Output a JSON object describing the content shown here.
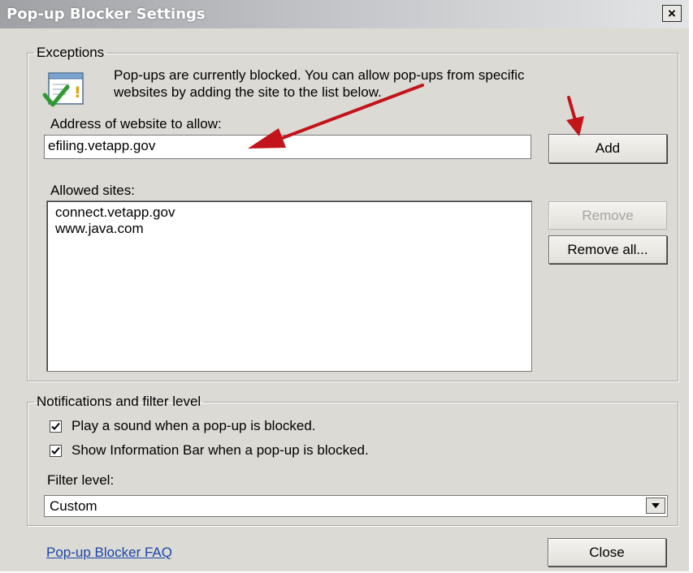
{
  "window": {
    "title": "Pop-up Blocker Settings",
    "close_glyph": "×"
  },
  "exceptions": {
    "legend": "Exceptions",
    "info_line1": "Pop-ups are currently blocked.  You can allow pop-ups from specific",
    "info_line2": "websites by adding the site to the list below.",
    "info_icon": "notepad-checkmark-warning-icon",
    "address_label": "Address of website to allow:",
    "address_value": "efiling.vetapp.gov",
    "add_label": "Add",
    "allowed_label": "Allowed sites:",
    "allowed_sites": [
      "connect.vetapp.gov",
      "www.java.com"
    ],
    "remove_label": "Remove",
    "remove_all_label": "Remove all..."
  },
  "notifications": {
    "legend": "Notifications and filter level",
    "play_sound_label": "Play a sound when a pop-up is blocked.",
    "play_sound_checked": true,
    "info_bar_label": "Show Information Bar when a pop-up is blocked.",
    "info_bar_checked": true,
    "filter_label": "Filter level:",
    "filter_value": "Custom"
  },
  "footer": {
    "faq_link": "Pop-up Blocker FAQ",
    "close_label": "Close"
  },
  "annotation_color": "#c2141a"
}
